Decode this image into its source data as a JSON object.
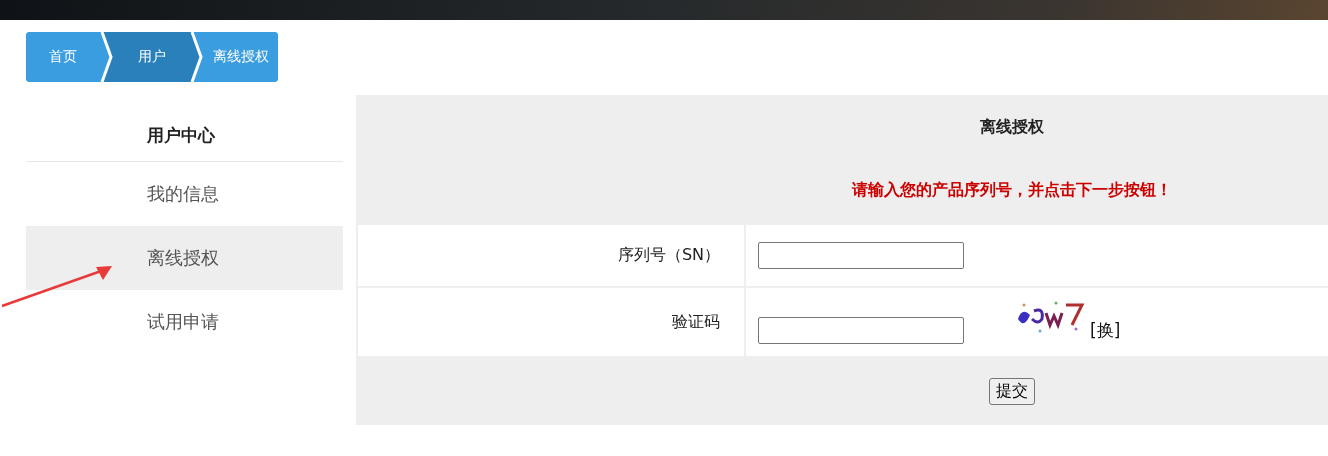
{
  "breadcrumb": [
    {
      "label": "首页",
      "selected": false
    },
    {
      "label": "用户",
      "selected": true
    },
    {
      "label": "离线授权",
      "selected": false
    }
  ],
  "sidebar": {
    "title": "用户中心",
    "items": [
      {
        "label": "我的信息",
        "selected": false
      },
      {
        "label": "离线授权",
        "selected": true
      },
      {
        "label": "试用申请",
        "selected": false
      }
    ]
  },
  "form": {
    "title": "离线授权",
    "message": "请输入您的产品序列号，并点击下一步按钮！",
    "fields": [
      {
        "label": "序列号（SN）",
        "kind": "text"
      },
      {
        "label": "验证码",
        "kind": "captcha",
        "refresh": "[换]"
      }
    ],
    "submit": "提交"
  }
}
